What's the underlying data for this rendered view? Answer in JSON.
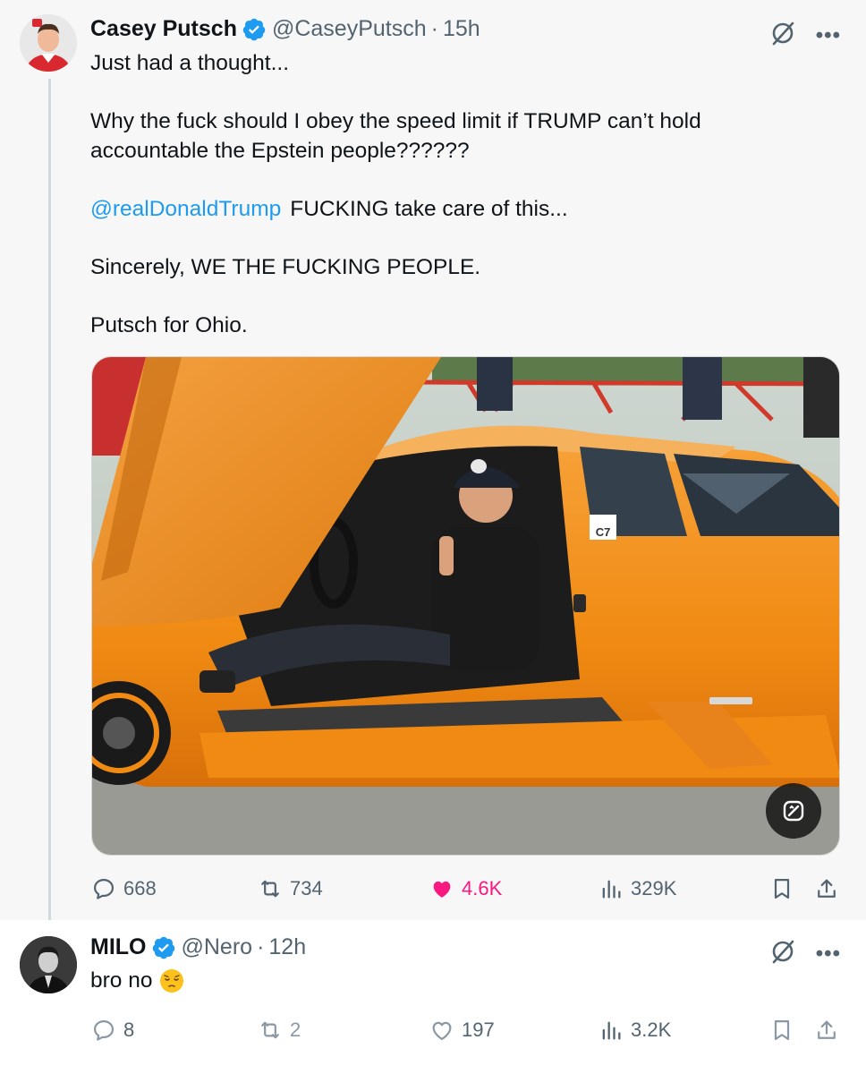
{
  "main_tweet": {
    "author_name": "Casey Putsch",
    "handle": "@CaseyPutsch",
    "separator": "·",
    "time": "15h",
    "text_line1": "Just had a thought...",
    "text_line2": "Why the fuck should I obey the speed limit if TRUMP can’t hold accountable the Epstein people??????",
    "mention": "@realDonaldTrump",
    "text_line3": "FUCKING take care of this...",
    "text_line4": "Sincerely, WE THE FUCKING PEOPLE.",
    "text_line5": "Putsch for Ohio.",
    "car_sticker": "C7",
    "stats": {
      "replies": "668",
      "reposts": "734",
      "likes": "4.6K",
      "views": "329K"
    }
  },
  "reply_tweet": {
    "author_name": "MILO",
    "handle": "@Nero",
    "separator": "·",
    "time": "12h",
    "text": "bro no",
    "emoji": "pensive-face",
    "stats": {
      "replies": "8",
      "reposts": "2",
      "likes": "197",
      "views": "3.2K"
    }
  },
  "colors": {
    "verified": "#1d9bf0",
    "link": "#1d9bf0",
    "like_active": "#f91880",
    "muted": "#536471",
    "car": "#f5941c"
  },
  "icons": [
    "verified-badge-icon",
    "grok-icon",
    "more-icon",
    "reply-icon",
    "repost-icon",
    "like-icon",
    "views-icon",
    "bookmark-icon",
    "share-icon",
    "edit-image-icon"
  ]
}
